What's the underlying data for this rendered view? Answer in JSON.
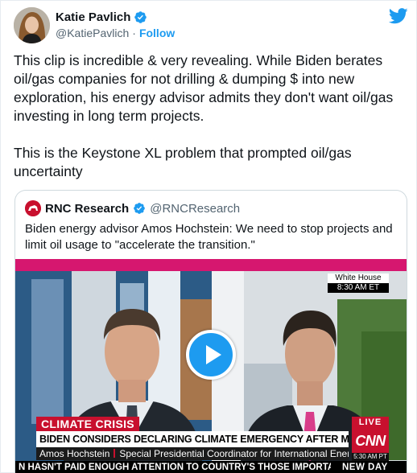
{
  "tweet": {
    "author_name": "Katie Pavlich",
    "author_handle": "@KatiePavlich",
    "follow_separator": "·",
    "follow_label": "Follow",
    "text": "This clip is incredible & very revealing. While Biden berates oil/gas companies for not drilling & dumping $ into new exploration, his energy advisor admits they don't want oil/gas investing in long term projects.\n\nThis is the Keystone XL problem that prompted oil/gas uncertainty"
  },
  "quoted": {
    "author_name": "RNC Research",
    "author_handle": "@RNCResearch",
    "text": "Biden energy advisor Amos Hochstein: We need to stop projects and limit oil usage to \"accelerate the transition.\""
  },
  "video": {
    "location_label": "White House",
    "location_time": "8:30 AM ET",
    "chyron_tag": "CLIMATE CRISIS",
    "headline": "BIDEN CONSIDERS DECLARING CLIMATE EMERGENCY AFTER MANCHIN ENDS TALKS",
    "speaker_name": "Amos Hochstein",
    "speaker_title": "Special Presidential Coordinator for International Energy Affairs",
    "live_label": "LIVE",
    "network": "CNN",
    "network_time": "5:30 AM PT",
    "ticker_text": "N HASN'T PAID ENOUGH ATTENTION TO COUNTRY'S THOSE IMPORTANT PRO",
    "show_name": "NEW DAY"
  },
  "icons": {
    "verified": "verified-badge-icon",
    "twitter": "twitter-bird-icon",
    "play": "play-icon"
  },
  "colors": {
    "accent": "#1d9bf0",
    "cnn_red": "#c8102e",
    "pink_bar": "#d6176f"
  }
}
